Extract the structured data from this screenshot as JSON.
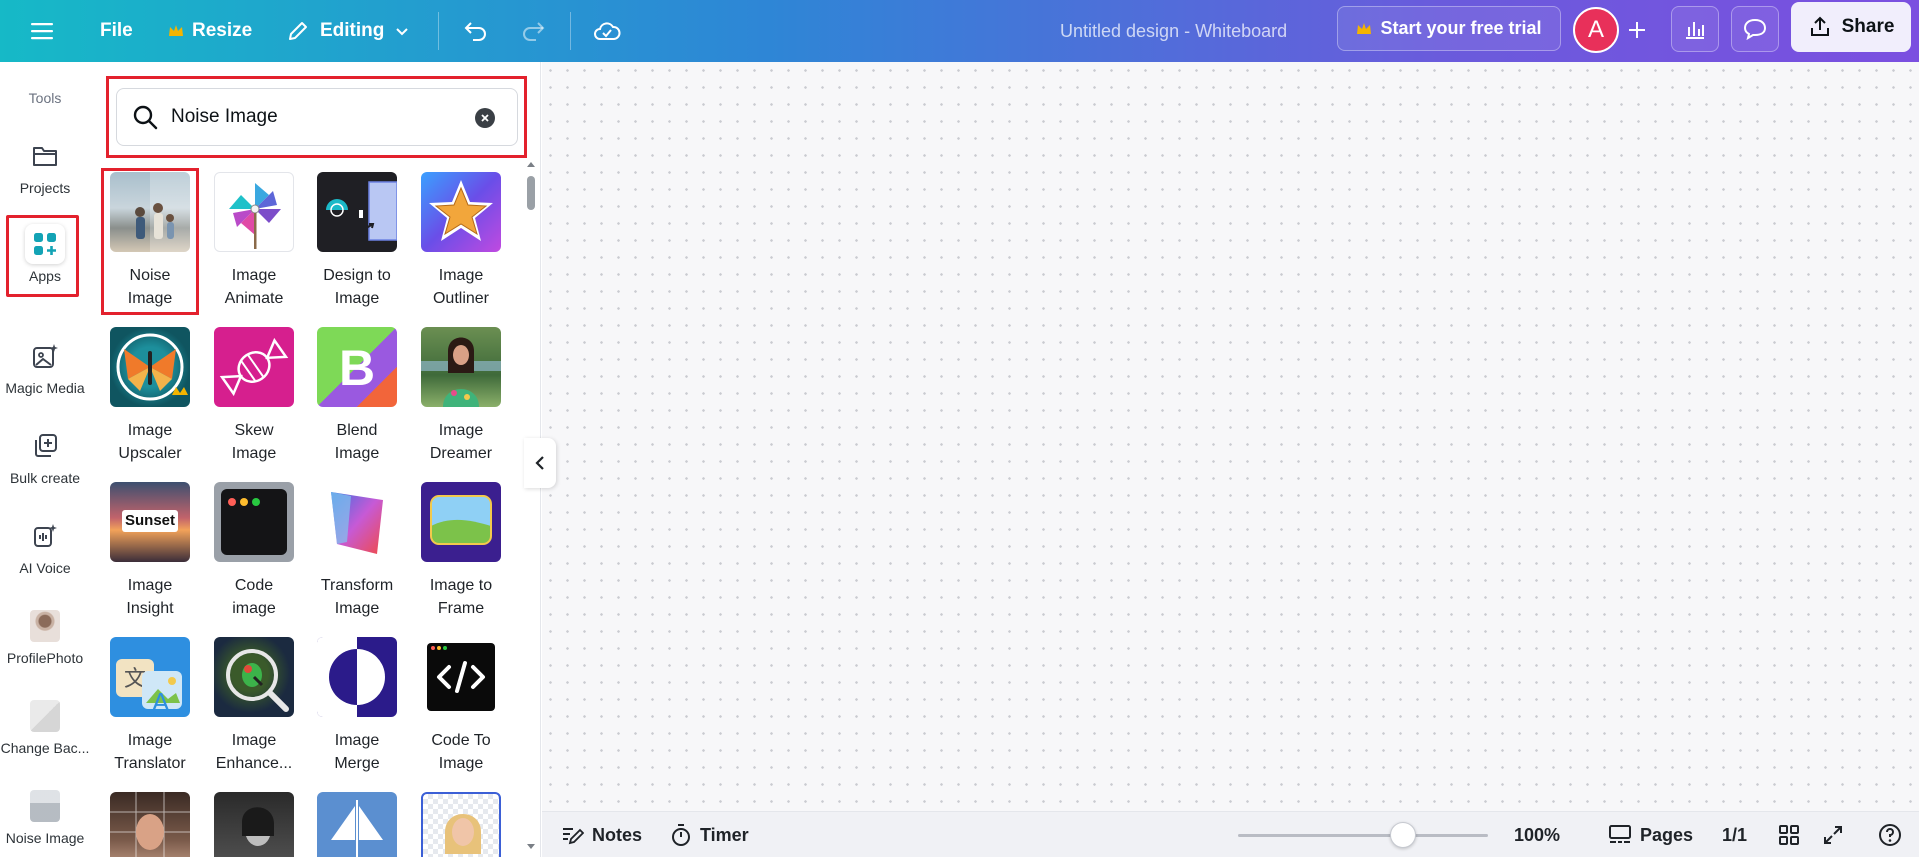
{
  "topbar": {
    "file_label": "File",
    "resize_label": "Resize",
    "editing_label": "Editing",
    "design_title": "Untitled design - Whiteboard",
    "trial_label": "Start your free trial",
    "avatar_letter": "A",
    "share_label": "Share",
    "colors": {
      "crown": "#f4b400",
      "avatar": "#e8305a"
    }
  },
  "rail": {
    "tools_label": "Tools",
    "items": [
      {
        "label": "Projects",
        "icon": "folder-icon"
      },
      {
        "label": "Apps",
        "icon": "apps-icon"
      },
      {
        "label": "Magic Media",
        "icon": "magic-media-icon"
      },
      {
        "label": "Bulk create",
        "icon": "bulk-create-icon"
      },
      {
        "label": "AI Voice",
        "icon": "ai-voice-icon"
      },
      {
        "label": "ProfilePhoto",
        "icon": "profile-photo-thumb"
      },
      {
        "label": "Change Bac...",
        "icon": "change-background-thumb"
      },
      {
        "label": "Noise Image",
        "icon": "noise-image-thumb"
      }
    ]
  },
  "search": {
    "value": "Noise Image"
  },
  "apps": [
    {
      "line1": "Noise",
      "line2": "Image"
    },
    {
      "line1": "Image",
      "line2": "Animate"
    },
    {
      "line1": "Design to",
      "line2": "Image"
    },
    {
      "line1": "Image",
      "line2": "Outliner"
    },
    {
      "line1": "Image",
      "line2": "Upscaler"
    },
    {
      "line1": "Skew",
      "line2": "Image"
    },
    {
      "line1": "Blend",
      "line2": "Image"
    },
    {
      "line1": "Image",
      "line2": "Dreamer"
    },
    {
      "line1": "Image",
      "line2": "Insight",
      "tile_text": "Sunset"
    },
    {
      "line1": "Code",
      "line2": "image"
    },
    {
      "line1": "Transform",
      "line2": "Image"
    },
    {
      "line1": "Image to",
      "line2": "Frame"
    },
    {
      "line1": "Image",
      "line2": "Translator"
    },
    {
      "line1": "Image",
      "line2": "Enhance..."
    },
    {
      "line1": "Image",
      "line2": "Merge"
    },
    {
      "line1": "Code To",
      "line2": "Image"
    }
  ],
  "bottombar": {
    "notes_label": "Notes",
    "timer_label": "Timer",
    "zoom_label": "100%",
    "zoom_fraction": 0.66,
    "pages_label": "Pages",
    "page_count": "1/1"
  }
}
